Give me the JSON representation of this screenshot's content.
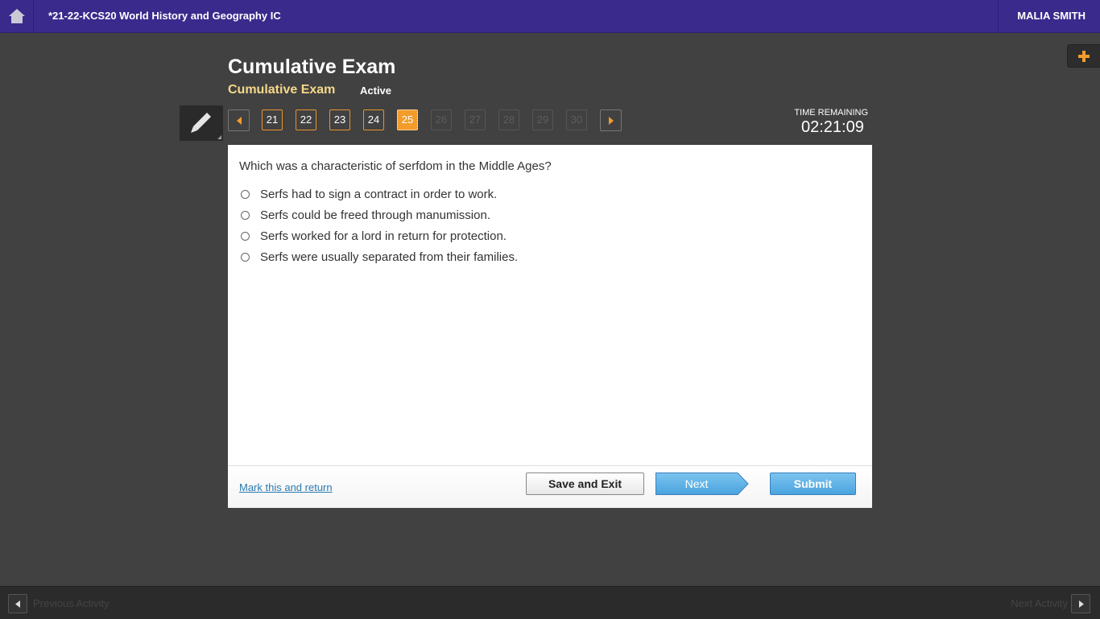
{
  "header": {
    "course_title": "*21-22-KCS20 World History and Geography IC",
    "user_name": "MALIA SMITH"
  },
  "exam": {
    "title": "Cumulative Exam",
    "subtitle": "Cumulative Exam",
    "status": "Active"
  },
  "question_nav": {
    "items": [
      {
        "label": "21",
        "state": "answered"
      },
      {
        "label": "22",
        "state": "answered"
      },
      {
        "label": "23",
        "state": "answered"
      },
      {
        "label": "24",
        "state": "answered"
      },
      {
        "label": "25",
        "state": "current"
      },
      {
        "label": "26",
        "state": "disabled"
      },
      {
        "label": "27",
        "state": "disabled"
      },
      {
        "label": "28",
        "state": "disabled"
      },
      {
        "label": "29",
        "state": "disabled"
      },
      {
        "label": "30",
        "state": "disabled"
      }
    ]
  },
  "timer": {
    "label": "TIME REMAINING",
    "value": "02:21:09"
  },
  "question": {
    "text": "Which was a characteristic of serfdom in the Middle Ages?",
    "choices": [
      "Serfs had to sign a contract in order to work.",
      "Serfs could be freed through manumission.",
      "Serfs worked for a lord in return for protection.",
      "Serfs were usually separated from their families."
    ]
  },
  "footer": {
    "mark_link": "Mark this and return",
    "save_exit": "Save and Exit",
    "next": "Next",
    "submit": "Submit"
  },
  "activity_nav": {
    "previous": "Previous Activity",
    "next": "Next Activity"
  },
  "colors": {
    "topbar": "#3a2a8c",
    "accent_orange": "#f39c2b",
    "button_blue": "#4aa3de"
  }
}
